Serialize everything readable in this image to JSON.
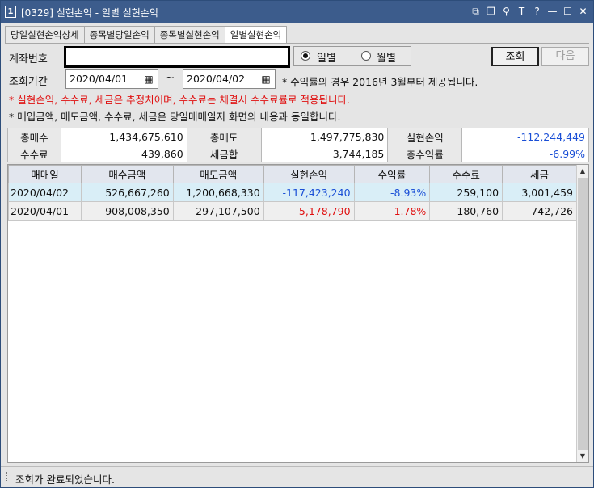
{
  "window": {
    "number": "1",
    "title": "[0329] 실현손익 - 일별 실현손익",
    "icons": [
      "restore-window-icon",
      "duplicate-window-icon",
      "pin-icon",
      "font-size-icon",
      "help-icon",
      "minimize-icon",
      "maximize-icon",
      "close-icon"
    ],
    "icon_glyphs": [
      "⧉",
      "❐",
      "⚲",
      "T",
      "?",
      "—",
      "☐",
      "✕"
    ]
  },
  "tabs": [
    {
      "label": "당일실현손익상세",
      "active": false
    },
    {
      "label": "종목별당일손익",
      "active": false
    },
    {
      "label": "종목별실현손익",
      "active": false
    },
    {
      "label": "일별실현손익",
      "active": true
    }
  ],
  "form": {
    "account_label": "계좌번호",
    "account_value": "",
    "period_label": "조회기간",
    "radio_daily": "일별",
    "radio_monthly": "월별",
    "selected_radio": "일별",
    "start_date": "2020/04/01",
    "end_date": "2020/04/02",
    "tilde": "~",
    "query_button": "조회",
    "next_button": "다음"
  },
  "notes": {
    "return_note": "* 수익률의 경우 2016년 3월부터 제공됩니다.",
    "estimate_note": "* 실현손익, 수수료, 세금은 추정치이며, 수수료는 체결시 수수료률로 적용됩니다.",
    "same_note": "* 매입금액, 매도금액, 수수료, 세금은 당일매매일지 화면의 내용과 동일합니다."
  },
  "summary": {
    "total_buy_label": "총매수",
    "total_buy": "1,434,675,610",
    "total_sell_label": "총매도",
    "total_sell": "1,497,775,830",
    "realized_label": "실현손익",
    "realized": "-112,244,449",
    "fee_label": "수수료",
    "fee": "439,860",
    "tax_label": "세금합",
    "tax": "3,744,185",
    "total_return_label": "총수익률",
    "total_return": "-6.99%"
  },
  "grid": {
    "columns": [
      "매매일",
      "매수금액",
      "매도금액",
      "실현손익",
      "수익률",
      "수수료",
      "세금"
    ],
    "rows": [
      {
        "date": "2020/04/02",
        "buy": "526,667,260",
        "sell": "1,200,668,330",
        "pnl": "-117,423,240",
        "ret": "-8.93%",
        "fee": "259,100",
        "tax": "3,001,459"
      },
      {
        "date": "2020/04/01",
        "buy": "908,008,350",
        "sell": "297,107,500",
        "pnl": "5,178,790",
        "ret": "1.78%",
        "fee": "180,760",
        "tax": "742,726"
      }
    ]
  },
  "status": {
    "message": "조회가 완료되었습니다."
  },
  "colors": {
    "titlebar": "#3c5c8c",
    "negative": "#1a4fd6",
    "positive": "#e01010",
    "selected_row": "#d9eef7"
  }
}
